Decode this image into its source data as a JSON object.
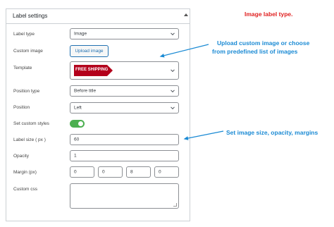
{
  "panel": {
    "title": "Label settings"
  },
  "fields": {
    "label_type": {
      "label": "Label type",
      "value": "Image"
    },
    "custom_image": {
      "label": "Custom image",
      "button": "Upload image"
    },
    "template": {
      "label": "Template",
      "banner_text": "FREE SHIPPING"
    },
    "position_type": {
      "label": "Position type",
      "value": "Before title"
    },
    "position": {
      "label": "Position",
      "value": "Left"
    },
    "custom_styles": {
      "label": "Set custom styles",
      "enabled": true
    },
    "label_size": {
      "label": "Label size ( px )",
      "value": "60"
    },
    "opacity": {
      "label": "Opacity",
      "value": "1"
    },
    "margin": {
      "label": "Margin (px)",
      "values": [
        "0",
        "0",
        "8",
        "0"
      ]
    },
    "custom_css": {
      "label": "Custom css",
      "value": ""
    }
  },
  "annotations": {
    "title": "Image label type.",
    "upload_note_line1": "Upload custom image or choose",
    "upload_note_line2": "from predefined list of images",
    "size_note": "Set image size, opacity, margins"
  },
  "colors": {
    "annotation_title": "#e02020",
    "annotation_text": "#1a8ad4",
    "toggle_on": "#4caf50",
    "banner": "#b3001b",
    "button_accent": "#2271b1"
  },
  "icons": {
    "collapse": "triangle-up-icon",
    "select": "chevron-down-icon"
  }
}
